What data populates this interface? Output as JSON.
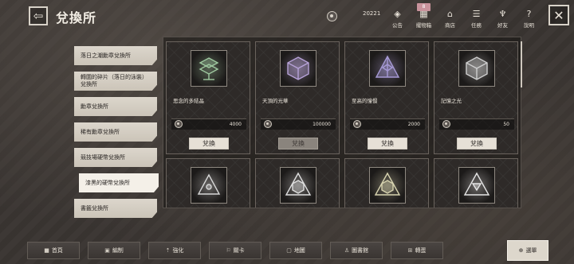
{
  "header": {
    "back_glyph": "⇦",
    "title": "兌換所",
    "currency_value": "20221",
    "nav": [
      {
        "icon": "announcement-icon",
        "glyph": "◈",
        "label": "公告",
        "badge": ""
      },
      {
        "icon": "warehouse-icon",
        "glyph": "▦",
        "label": "擺物箱",
        "badge": "8"
      },
      {
        "icon": "shop-icon",
        "glyph": "⌂",
        "label": "商店",
        "badge": ""
      },
      {
        "icon": "task-icon",
        "glyph": "☰",
        "label": "任務",
        "badge": ""
      },
      {
        "icon": "friends-icon",
        "glyph": "♆",
        "label": "好友",
        "badge": ""
      },
      {
        "icon": "help-icon",
        "glyph": "?",
        "label": "說明",
        "badge": ""
      }
    ],
    "close_glyph": "✕"
  },
  "sidebar": {
    "items": [
      {
        "label": "落日之潮勳章兌換所",
        "active": false
      },
      {
        "label": "轉圜的碎片（落日的泳裝）兌換所",
        "active": false
      },
      {
        "label": "勳章兌換所",
        "active": false
      },
      {
        "label": "稀有勳章兌換所",
        "active": false
      },
      {
        "label": "競技場硬幣兌換所",
        "active": false
      },
      {
        "label": "漆黑的硬幣兌換所",
        "active": true
      },
      {
        "label": "書籤兌換所",
        "active": false
      }
    ]
  },
  "items": [
    {
      "name": "思念的多結晶",
      "price": "4000",
      "button": "兌換",
      "enabled": true,
      "tint": "#9fc9a0",
      "shape": "cube-stack"
    },
    {
      "name": "天頂的光華",
      "price": "100000",
      "button": "兌換",
      "enabled": false,
      "tint": "#b7a2d8",
      "shape": "cube"
    },
    {
      "name": "至高的憧憬",
      "price": "2000",
      "button": "兌換",
      "enabled": true,
      "tint": "#a79ad6",
      "shape": "pyramid"
    },
    {
      "name": "記憶之光",
      "price": "50",
      "button": "兌換",
      "enabled": true,
      "tint": "#cfcfcf",
      "shape": "cube"
    },
    {
      "name": "",
      "price": "",
      "button": "",
      "enabled": true,
      "tint": "#d8d8d8",
      "shape": "triangle"
    },
    {
      "name": "",
      "price": "",
      "button": "",
      "enabled": true,
      "tint": "#e0e0e0",
      "shape": "triangle-cube"
    },
    {
      "name": "",
      "price": "",
      "button": "",
      "enabled": true,
      "tint": "#d8d4b0",
      "shape": "triangle-cube"
    },
    {
      "name": "",
      "price": "",
      "button": "",
      "enabled": true,
      "tint": "#e6e6e6",
      "shape": "triangle-arrow"
    }
  ],
  "bottom_tabs": [
    {
      "icon": "home-icon",
      "glyph": "■",
      "label": "首頁",
      "active": false
    },
    {
      "icon": "formation-icon",
      "glyph": "▣",
      "label": "編制",
      "active": false
    },
    {
      "icon": "enhance-icon",
      "glyph": "⇡",
      "label": "強化",
      "active": false
    },
    {
      "icon": "stage-icon",
      "glyph": "⚐",
      "label": "關卡",
      "active": false
    },
    {
      "icon": "map-icon",
      "glyph": "▢",
      "label": "地圖",
      "active": false
    },
    {
      "icon": "library-icon",
      "glyph": "♙",
      "label": "圖書館",
      "active": false
    },
    {
      "icon": "gacha-icon",
      "glyph": "⊞",
      "label": "轉蛋",
      "active": false
    },
    {
      "icon": "menu-icon",
      "glyph": "⊕",
      "label": "選單",
      "active": true
    }
  ]
}
